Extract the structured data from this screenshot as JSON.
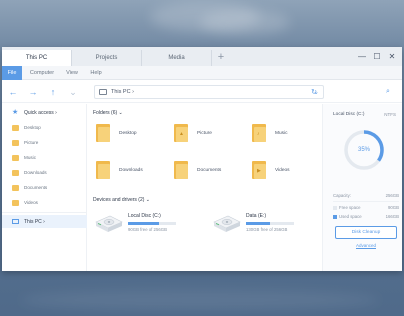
{
  "tabs": [
    {
      "label": "This PC",
      "active": true
    },
    {
      "label": "Projects",
      "active": false
    },
    {
      "label": "Media",
      "active": false
    }
  ],
  "tab_add_symbol": "+",
  "window_controls": {
    "minimize": "—",
    "maximize": "☐",
    "close": "✕"
  },
  "menu": [
    "File",
    "Computer",
    "View",
    "Help"
  ],
  "nav": {
    "back": "←",
    "forward": "→",
    "up": "↑",
    "dropdown": "⌄"
  },
  "address": {
    "path": "This PC ›",
    "dropdown": "⌄",
    "refresh": "↻",
    "search": "⌕"
  },
  "sidebar": {
    "quick_access": "Quick access ›",
    "items": [
      "Desktop",
      "Picture",
      "Music",
      "Downloads",
      "Documents",
      "Videos"
    ],
    "this_pc": "This PC ›"
  },
  "main": {
    "folders_title": "Folders (6) ⌄",
    "folders": [
      {
        "name": "Desktop",
        "glyph": ""
      },
      {
        "name": "Picture",
        "glyph": "▲"
      },
      {
        "name": "Music",
        "glyph": "♪"
      },
      {
        "name": "Downloads",
        "glyph": ""
      },
      {
        "name": "Documents",
        "glyph": ""
      },
      {
        "name": "Videos",
        "glyph": "▶"
      }
    ],
    "drives_title": "Devices and drivers (2) ⌄",
    "drives": [
      {
        "name": "Local Disc (C:)",
        "free_text": "90GB free of 256GB",
        "used_fraction": 0.65
      },
      {
        "name": "Data (E:)",
        "free_text": "130GB free of 256GB",
        "used_fraction": 0.49
      }
    ]
  },
  "panel": {
    "title": "Local Disc (C:)",
    "fs": "NTFS",
    "usage_percent": 35,
    "usage_label": "35%",
    "stats": [
      {
        "label": "Capacity:",
        "value": "256GB",
        "color": ""
      },
      {
        "label": "Free space",
        "value": "90GB",
        "color": "#e4e9ef"
      },
      {
        "label": "Used space",
        "value": "166GB",
        "color": "#5b9be6"
      }
    ],
    "cleanup_button": "Disk Cleanup",
    "advanced_link": "Advanced"
  },
  "colors": {
    "accent": "#5b9be6",
    "folder": "#f3c35c"
  }
}
